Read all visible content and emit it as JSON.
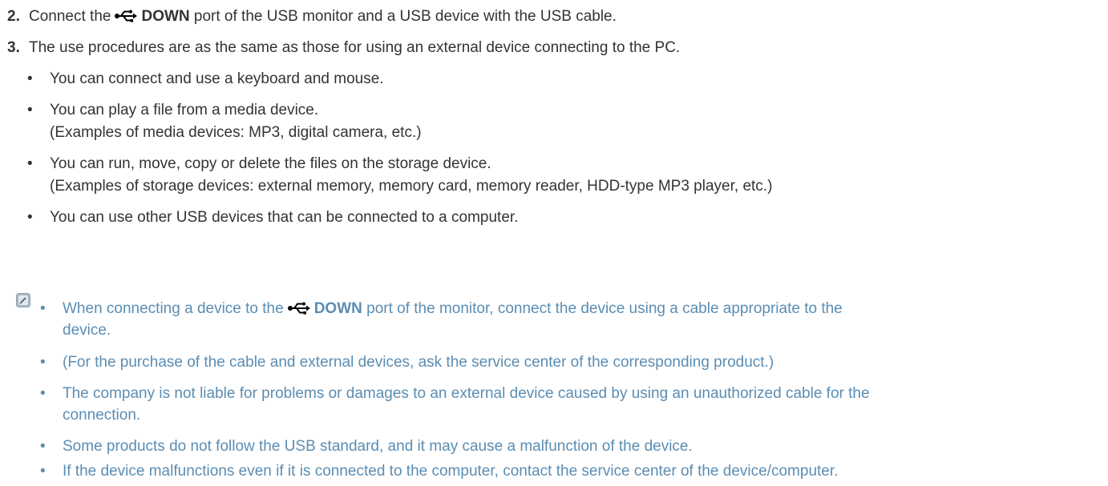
{
  "steps": [
    {
      "num": "2.",
      "pre": "Connect the",
      "bold": "DOWN",
      "post": "port of the USB monitor and a USB device with the USB cable."
    },
    {
      "num": "3.",
      "text": "The use procedures are as the same as those for using an external device connecting to the PC."
    }
  ],
  "bullet": "•",
  "items": [
    {
      "line1": "You can connect and use a keyboard and mouse."
    },
    {
      "line1": "You can play a file from a media device.",
      "line2": "(Examples of media devices: MP3, digital camera, etc.)"
    },
    {
      "line1": "You can run, move, copy or delete the files on the storage device.",
      "line2": "(Examples of storage devices: external memory, memory card, memory reader, HDD-type MP3 player, etc.)"
    },
    {
      "line1": "You can use other USB devices that can be connected to a computer."
    }
  ],
  "notes": [
    {
      "pre": "When connecting a device to the",
      "bold": "DOWN",
      "post": "port of the monitor, connect the device using a cable appropriate to the",
      "line2": "device."
    },
    {
      "line1": "(For the purchase of the cable and external devices, ask the service center of the corresponding product.)"
    },
    {
      "line1": "The company is not liable for problems or damages to an external device caused by using an unauthorized cable for the",
      "line2": "connection."
    },
    {
      "line1": "Some products do not follow the USB standard, and it may cause a malfunction of the device."
    },
    {
      "line1": "If the device malfunctions even if it is connected to the computer, contact the service center of the device/computer."
    }
  ],
  "icons": {
    "usb": "usb-icon",
    "note": "note-icon"
  },
  "colors": {
    "text": "#333333",
    "note": "#5b8db3"
  }
}
